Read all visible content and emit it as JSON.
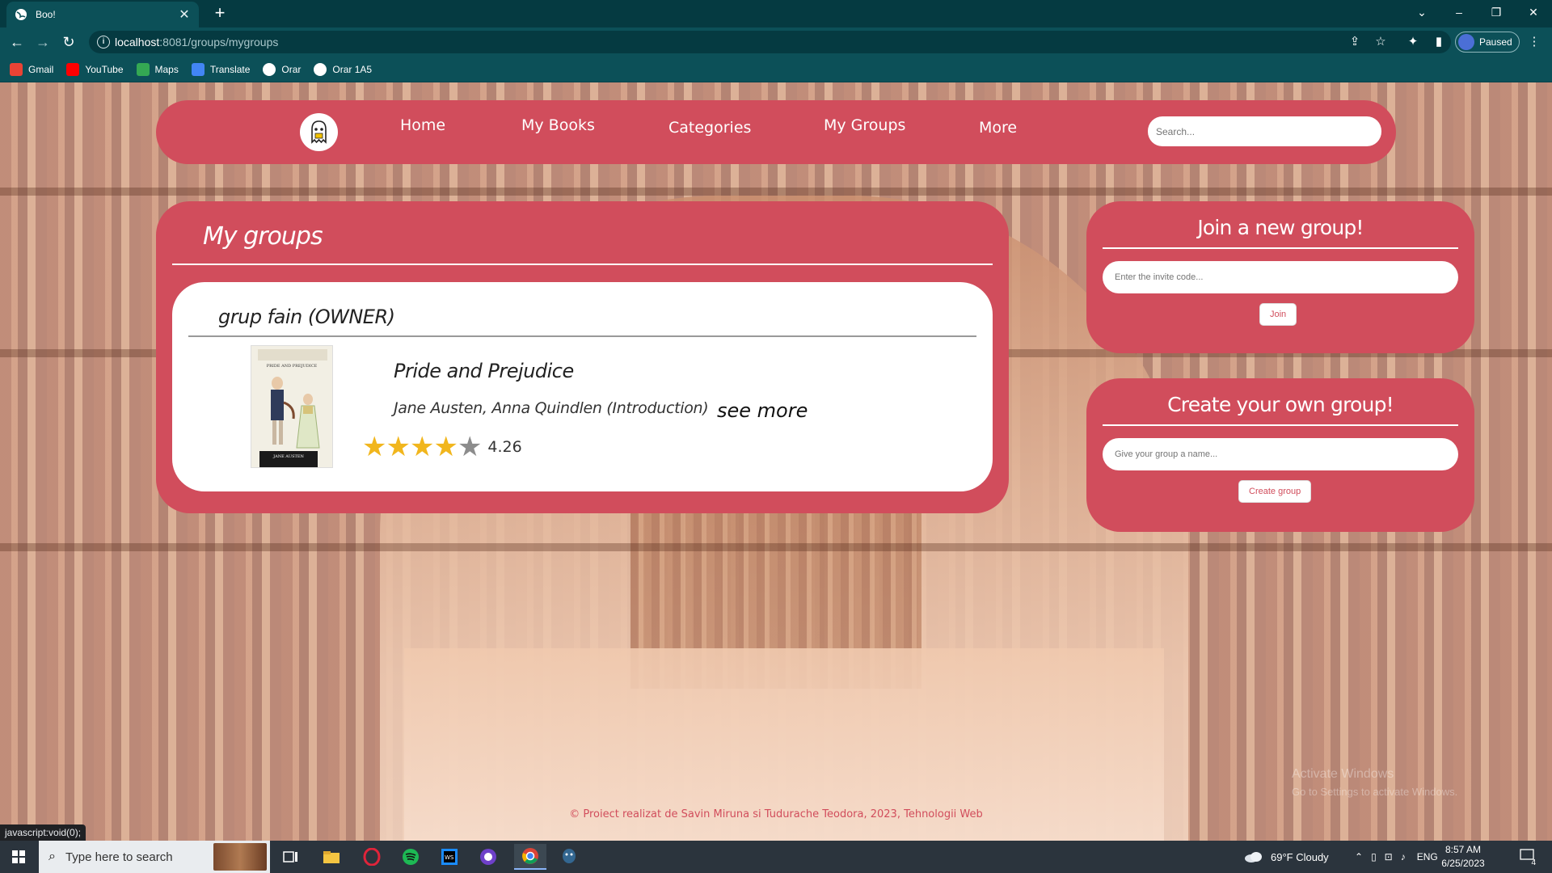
{
  "browser": {
    "tab_title": "Boo!",
    "tab_close": "✕",
    "new_tab": "+",
    "url_host": "localhost",
    "url_path": ":8081/groups/mygroups",
    "profile_label": "Paused",
    "window_controls": [
      "⌄",
      "–",
      "❐",
      "✕"
    ],
    "status_text": "javascript:void(0);"
  },
  "bookmarks": [
    {
      "label": "Gmail",
      "icon": "gmail-icon",
      "color": "#ea4335"
    },
    {
      "label": "YouTube",
      "icon": "youtube-icon",
      "color": "#ff0000"
    },
    {
      "label": "Maps",
      "icon": "maps-icon",
      "color": "#34a853"
    },
    {
      "label": "Translate",
      "icon": "translate-icon",
      "color": "#4285f4"
    },
    {
      "label": "Orar",
      "icon": "globe-icon",
      "color": "#ffffff"
    },
    {
      "label": "Orar 1A5",
      "icon": "globe-icon",
      "color": "#ffffff"
    }
  ],
  "nav": {
    "links": [
      "Home",
      "My Books",
      "Categories",
      "My Groups",
      "More"
    ],
    "search_placeholder": "Search..."
  },
  "groups": {
    "title": "My groups",
    "items": [
      {
        "name": "grup fain (OWNER)",
        "book": {
          "title": "Pride and Prejudice",
          "authors": "Jane Austen, Anna Quindlen (Introduction)",
          "cover_title": "PRIDE AND PREJUDICE",
          "cover_author": "JANE AUSTEN",
          "rating": "4.26",
          "rating_value": 4.26
        },
        "see_more": "see more"
      }
    ]
  },
  "join": {
    "title": "Join a new group!",
    "placeholder": "Enter the invite code...",
    "button": "Join"
  },
  "create": {
    "title": "Create your own group!",
    "placeholder": "Give your group a name...",
    "button": "Create group"
  },
  "footer": "© Proiect realizat de Savin Miruna si Tudurache Teodora, 2023, Tehnologii Web",
  "watermark": {
    "line1": "Activate Windows",
    "line2": "Go to Settings to activate Windows."
  },
  "taskbar": {
    "search_placeholder": "Type here to search",
    "weather": "69°F  Cloudy",
    "language": "ENG",
    "time": "8:57 AM",
    "date": "6/25/2023",
    "notifications": "4"
  },
  "colors": {
    "accent": "#d14d5c",
    "chrome": "#0c5058",
    "chrome_dark": "#053a41"
  }
}
